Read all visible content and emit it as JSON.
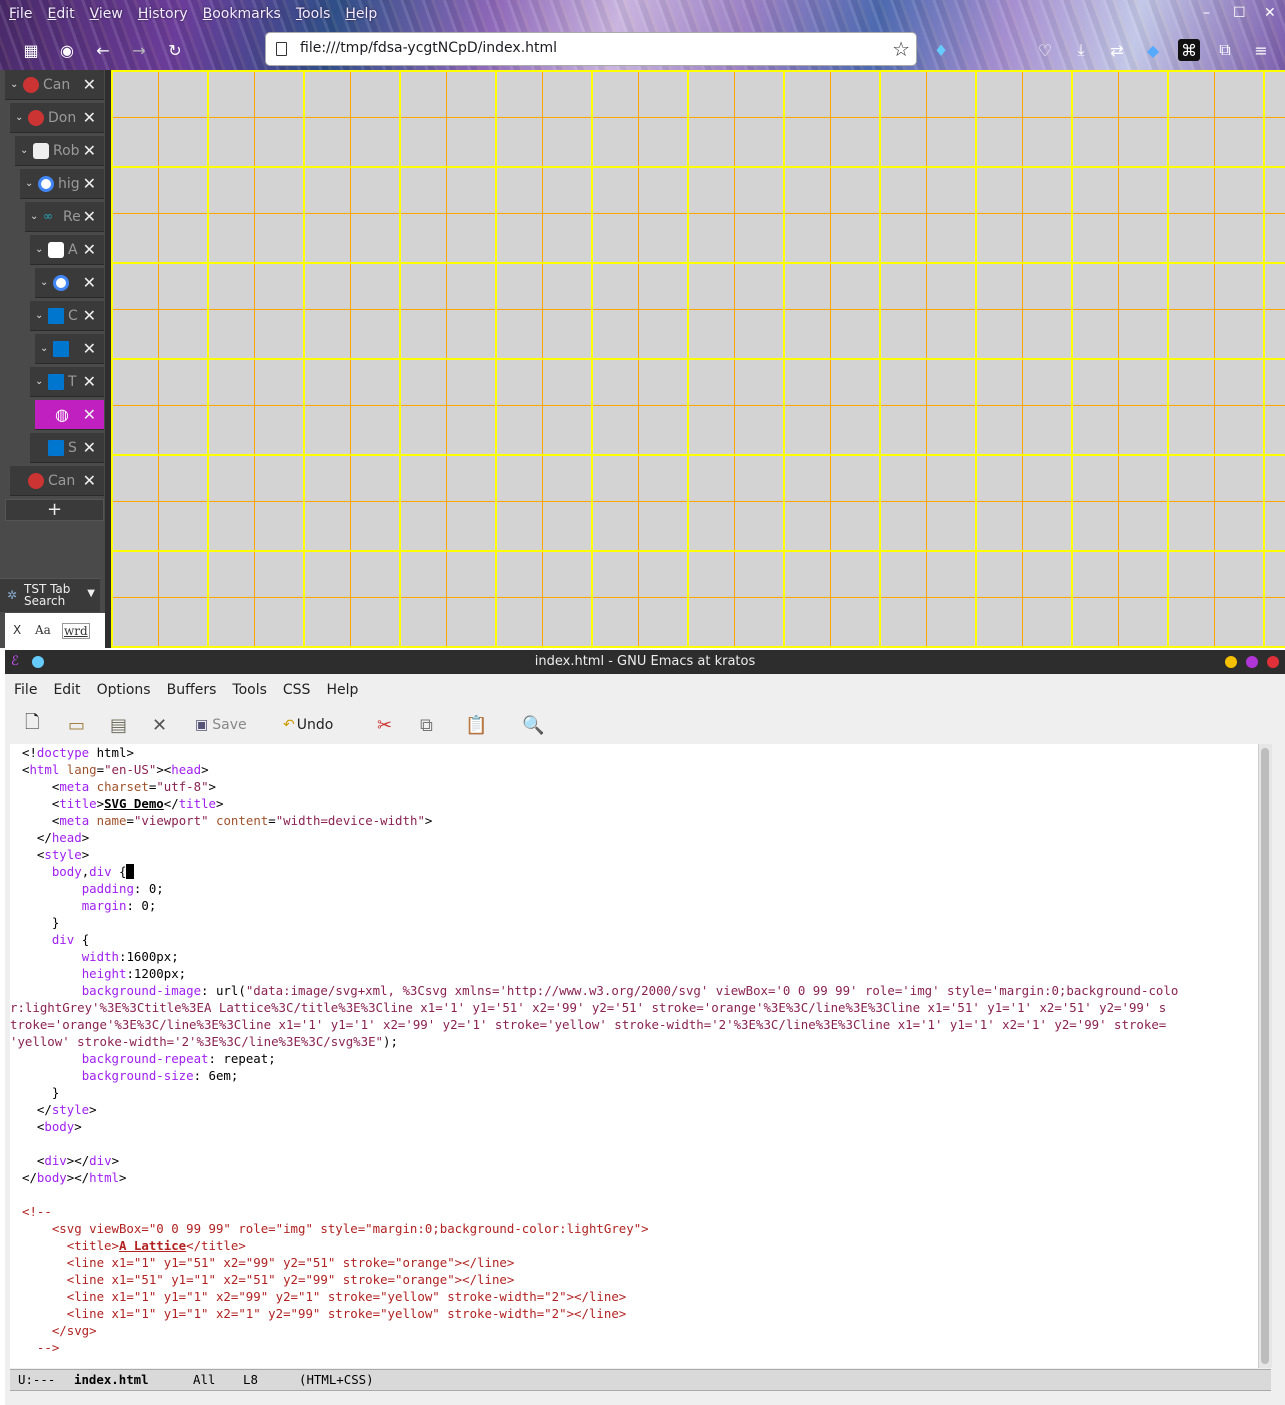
{
  "firefox": {
    "menu": [
      "File",
      "Edit",
      "View",
      "History",
      "Bookmarks",
      "Tools",
      "Help"
    ],
    "url": "file:///tmp/fdsa-ycgtNCpD/index.html",
    "window_controls": [
      "–",
      "☐",
      "✕"
    ],
    "tabs": [
      {
        "title": "Can a",
        "favicon": "apple-icon",
        "active": false
      },
      {
        "title": "Don",
        "favicon": "apple-icon",
        "active": false
      },
      {
        "title": "Rob",
        "favicon": "robinhood-icon",
        "active": false
      },
      {
        "title": "hig",
        "favicon": "google-icon",
        "active": false
      },
      {
        "title": "Re",
        "favicon": "link-icon",
        "active": false
      },
      {
        "title": "A",
        "favicon": "amazon-icon",
        "active": false
      },
      {
        "title": "",
        "favicon": "google-icon",
        "active": false
      },
      {
        "title": "C",
        "favicon": "dell-icon",
        "active": false
      },
      {
        "title": "",
        "favicon": "dell-icon",
        "active": false
      },
      {
        "title": "T",
        "favicon": "dell-icon",
        "active": false
      },
      {
        "title": "",
        "favicon": "globe-icon",
        "active": true
      },
      {
        "title": "S",
        "favicon": "dell-icon",
        "active": false
      },
      {
        "title": "Can",
        "favicon": "apple-icon",
        "active": false
      }
    ],
    "new_tab_label": "+",
    "tst_search_label": "TST Tab Search",
    "tst_foot": {
      "close": "X",
      "case": "Aa",
      "word": "wrd"
    }
  },
  "emacs": {
    "title": "index.html - GNU Emacs at kratos",
    "menu": [
      "File",
      "Edit",
      "Options",
      "Buffers",
      "Tools",
      "CSS",
      "Help"
    ],
    "toolbar": {
      "save": "Save",
      "undo": "Undo"
    },
    "modeline": {
      "state": "U:---",
      "buffer": "index.html",
      "position": "All",
      "line": "L8",
      "mode": "(HTML+CSS)"
    }
  }
}
